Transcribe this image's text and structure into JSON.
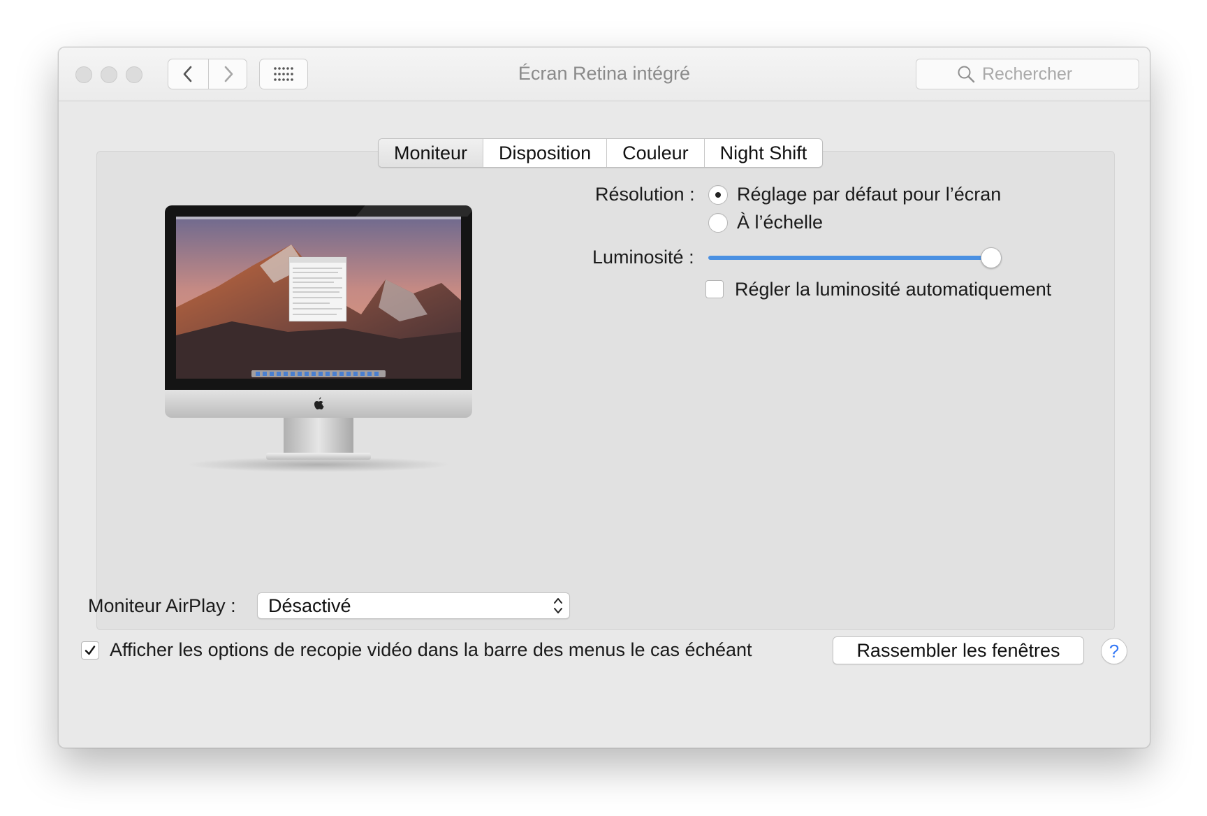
{
  "window": {
    "title": "Écran Retina intégré",
    "search_placeholder": "Rechercher"
  },
  "toolbar": {
    "back_icon": "chevron-left-icon",
    "forward_icon": "chevron-right-icon",
    "show_all_icon": "grid-icon"
  },
  "tabs": [
    {
      "label": "Moniteur",
      "selected": true
    },
    {
      "label": "Disposition",
      "selected": false
    },
    {
      "label": "Couleur",
      "selected": false
    },
    {
      "label": "Night Shift",
      "selected": false
    }
  ],
  "monitor": {
    "resolution_label": "Résolution :",
    "resolution_options": [
      {
        "label": "Réglage par défaut pour l’écran",
        "selected": true
      },
      {
        "label": "À l’échelle",
        "selected": false
      }
    ],
    "brightness_label": "Luminosité :",
    "brightness_level": 1.0,
    "auto_brightness_label": "Régler la luminosité automatiquement",
    "auto_brightness_checked": false
  },
  "airplay": {
    "label": "Moniteur AirPlay :",
    "value": "Désactivé"
  },
  "mirroring": {
    "label": "Afficher les options de recopie vidéo dans la barre des menus le cas échéant",
    "checked": true
  },
  "gather_button": "Rassembler les fenêtres",
  "help_button": "?",
  "colors": {
    "accent": "#4a90e2",
    "window_bg": "#e9e9e9",
    "panel_bg": "#e1e1e1"
  }
}
